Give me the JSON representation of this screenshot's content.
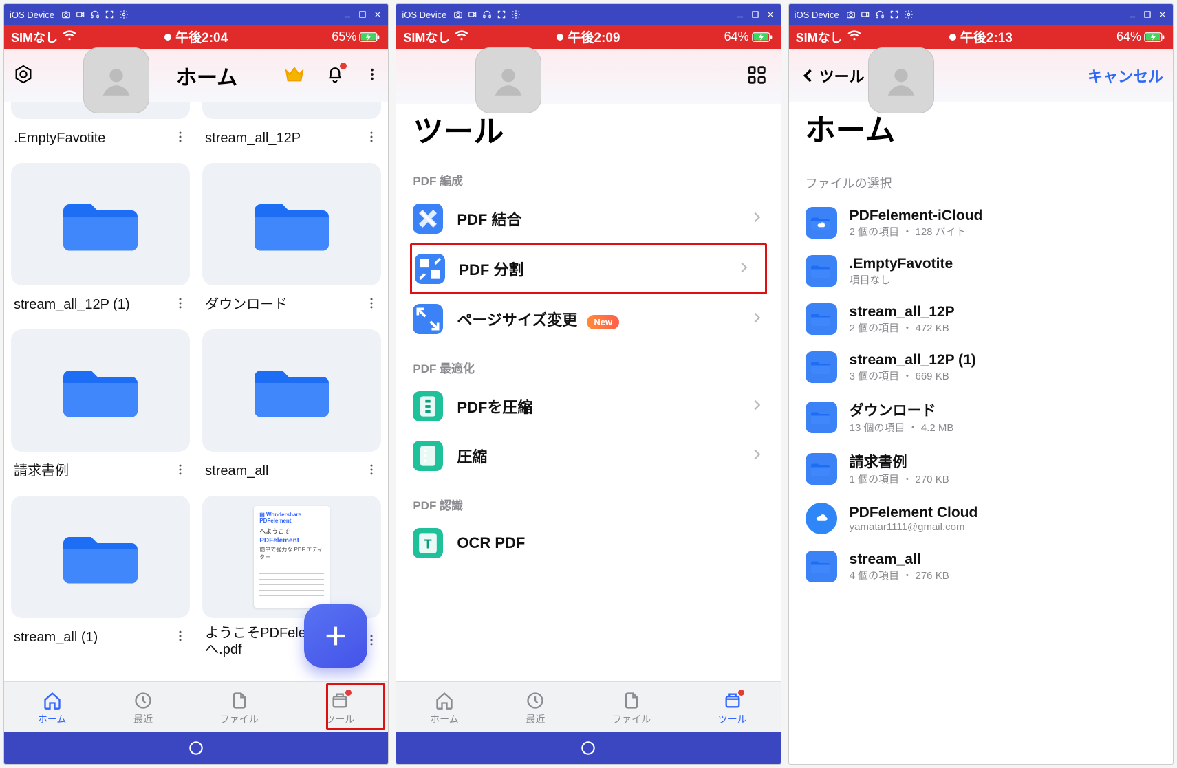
{
  "window": {
    "title": "iOS Device"
  },
  "status": {
    "sim": "SIMなし",
    "time1": "午後2:04",
    "time2": "午後2:09",
    "time3": "午後2:13",
    "battery1": "65%",
    "battery2": "64%",
    "battery3": "64%"
  },
  "screen1": {
    "title": "ホーム",
    "folders": [
      {
        "name": ".EmptyFavotite",
        "cut": true
      },
      {
        "name": "stream_all_12P",
        "cut": true
      },
      {
        "name": "stream_all_12P (1)"
      },
      {
        "name": "ダウンロード"
      },
      {
        "name": "請求書例"
      },
      {
        "name": "stream_all"
      },
      {
        "name": "stream_all (1)"
      },
      {
        "name": "ようこそPDFelementへ.pdf",
        "isDoc": true,
        "doc": {
          "welcome": "へようこそ",
          "brand": "PDFelement",
          "tag": "簡単で強力な PDF エディター"
        }
      }
    ],
    "tabs": {
      "home": "ホーム",
      "recent": "最近",
      "files": "ファイル",
      "tools": "ツール"
    }
  },
  "screen2": {
    "title": "ツール",
    "sections": {
      "edit": "PDF 編成",
      "optimize": "PDF 最適化",
      "recognize": "PDF 認識"
    },
    "tools": {
      "merge": "PDF 結合",
      "split": "PDF 分割",
      "pagesize": "ページサイズ変更",
      "new_badge": "New",
      "compress_pdf": "PDFを圧縮",
      "compress": "圧縮",
      "ocr": "OCR PDF"
    },
    "tabs": {
      "home": "ホーム",
      "recent": "最近",
      "files": "ファイル",
      "tools": "ツール"
    }
  },
  "screen3": {
    "back_label": "ツール",
    "cancel": "キャンセル",
    "title": "ホーム",
    "section": "ファイルの選択",
    "files": [
      {
        "name": "PDFelement-iCloud",
        "meta": "2 個の項目 ・ 128 バイト",
        "icon": "cloud-folder"
      },
      {
        "name": ".EmptyFavotite",
        "meta": "項目なし",
        "icon": "folder"
      },
      {
        "name": "stream_all_12P",
        "meta": "2 個の項目 ・ 472 KB",
        "icon": "folder"
      },
      {
        "name": "stream_all_12P (1)",
        "meta": "3 個の項目 ・ 669 KB",
        "icon": "folder"
      },
      {
        "name": "ダウンロード",
        "meta": "13 個の項目 ・ 4.2 MB",
        "icon": "folder"
      },
      {
        "name": "請求書例",
        "meta": "1 個の項目 ・ 270 KB",
        "icon": "folder"
      },
      {
        "name": "PDFelement Cloud",
        "meta": "yamatar1111@gmail.com",
        "icon": "cloud"
      },
      {
        "name": "stream_all",
        "meta": "4 個の項目 ・ 276 KB",
        "icon": "folder"
      }
    ]
  }
}
